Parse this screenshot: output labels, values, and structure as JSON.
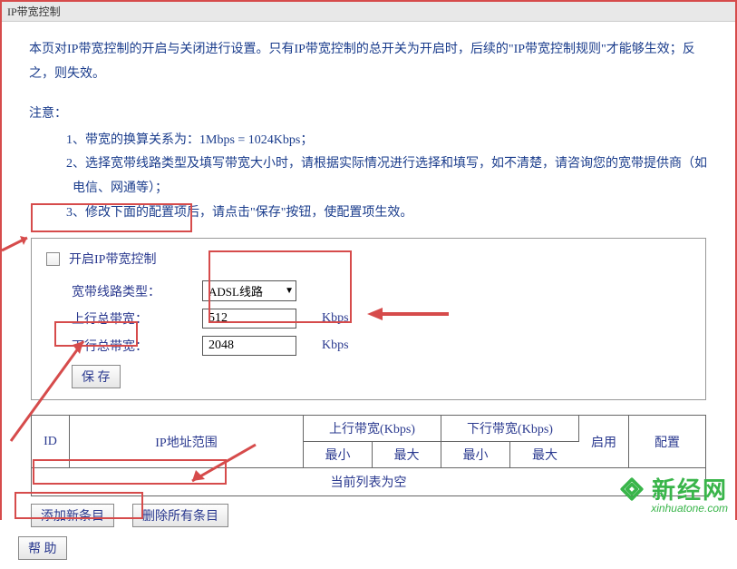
{
  "title": "IP带宽控制",
  "intro": "本页对IP带宽控制的开启与关闭进行设置。只有IP带宽控制的总开关为开启时，后续的\"IP带宽控制规则\"才能够生效；反之，则失效。",
  "notes_title": "注意：",
  "note1": "1、带宽的换算关系为：1Mbps = 1024Kbps；",
  "note2": "2、选择宽带线路类型及填写带宽大小时，请根据实际情况进行选择和填写，如不清楚，请咨询您的宽带提供商（如电信、网通等）；",
  "note3": "3、修改下面的配置项后，请点击\"保存\"按钮，使配置项生效。",
  "enable_label": "开启IP带宽控制",
  "line_type_label": "宽带线路类型：",
  "line_type_value": "ADSL线路",
  "uplink_label": "上行总带宽：",
  "uplink_value": "512",
  "downlink_label": "下行总带宽：",
  "downlink_value": "2048",
  "unit": "Kbps",
  "save_label": "保 存",
  "table": {
    "id": "ID",
    "ip_range": "IP地址范围",
    "uplink_header": "上行带宽(Kbps)",
    "downlink_header": "下行带宽(Kbps)",
    "min": "最小",
    "max": "最大",
    "enable": "启用",
    "config": "配置",
    "empty": "当前列表为空"
  },
  "add_label": "添加新条目",
  "delete_all_label": "删除所有条目",
  "help_label": "帮 助",
  "watermark_text": "新经网",
  "watermark_url": "xinhuatone.com"
}
